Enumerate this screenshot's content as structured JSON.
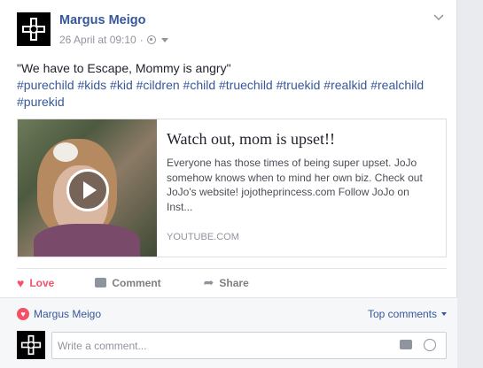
{
  "post": {
    "author": "Margus Meigo",
    "timestamp": "26 April at 09:10",
    "separator": "·",
    "text": "\"We have to Escape, Mommy is angry\"",
    "hashtags": "#purechild #kids #kid #cildren #child #truechild #truekid #realkid #realchild #purekid"
  },
  "card": {
    "title": "Watch out, mom is upset!!",
    "description": "Everyone has those times of being super upset. JoJo somehow knows when to mind her own biz. Check out JoJo's website! jojotheprincess.com Follow JoJo on Inst...",
    "source": "YOUTUBE.COM"
  },
  "actions": {
    "love": "Love",
    "comment": "Comment",
    "share": "Share"
  },
  "footer": {
    "liker": "Margus Meigo",
    "top_comments": "Top comments",
    "comment_placeholder": "Write a comment..."
  },
  "colors": {
    "link": "#365899",
    "love": "#f25268",
    "muted": "#90949c"
  }
}
